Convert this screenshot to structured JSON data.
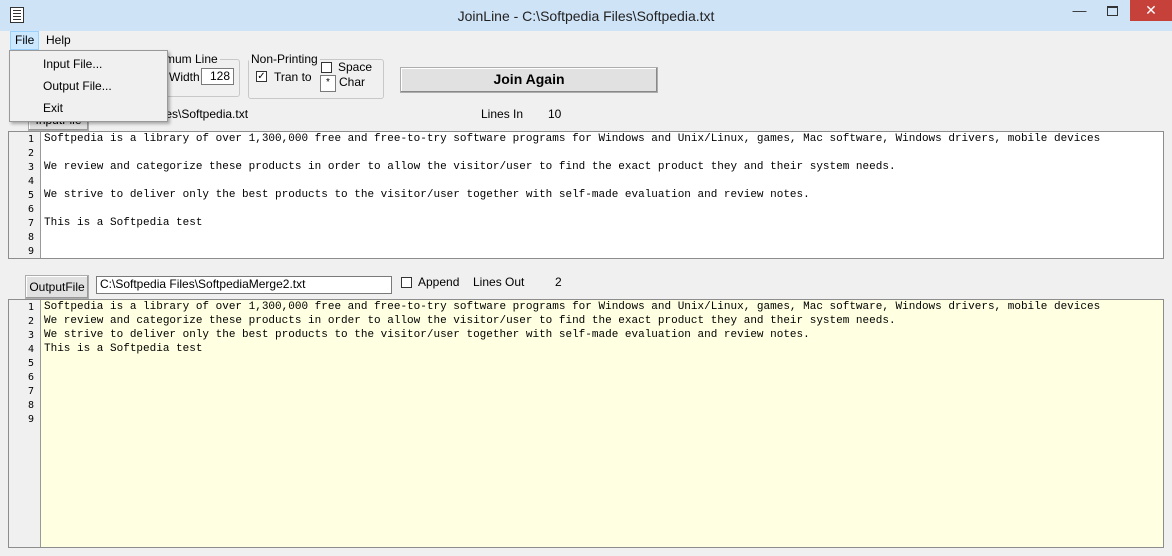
{
  "window": {
    "title": "JoinLine - C:\\Softpedia Files\\Softpedia.txt",
    "minimize": "—",
    "close": "✕"
  },
  "menubar": {
    "file": "File",
    "help": "Help"
  },
  "file_menu": {
    "items": [
      "Input File...",
      "Output File...",
      "Exit"
    ]
  },
  "min_line": {
    "legend": "inimum Line",
    "width_label": "Width",
    "width_value": "128"
  },
  "non_printing": {
    "legend": "Non-Printing",
    "tran_label": "Tran to",
    "tran_checked": "✓",
    "space_label": "Space",
    "char_label": "Char",
    "char_value": "*"
  },
  "join_button": "Join Again",
  "input": {
    "button": "InputFile",
    "path": "iles\\Softpedia.txt",
    "lines_label": "Lines In",
    "lines_value": "10"
  },
  "output": {
    "button": "OutputFile",
    "path": "C:\\Softpedia Files\\SoftpediaMerge2.txt",
    "append_label": "Append",
    "lines_label": "Lines Out",
    "lines_value": "2"
  },
  "input_lines": [
    {
      "n": "1",
      "t": "Softpedia is a library of over 1,300,000 free and free-to-try software programs for Windows and Unix/Linux, games, Mac software, Windows drivers, mobile devices"
    },
    {
      "n": "2",
      "t": ""
    },
    {
      "n": "3",
      "t": "We review and categorize these products in order to allow the visitor/user to find the exact product they and their system needs."
    },
    {
      "n": "4",
      "t": ""
    },
    {
      "n": "5",
      "t": "We strive to deliver only the best products to the visitor/user together with self-made evaluation and review notes."
    },
    {
      "n": "6",
      "t": ""
    },
    {
      "n": "7",
      "t": "This is a Softpedia test"
    },
    {
      "n": "8",
      "t": ""
    },
    {
      "n": "9",
      "t": ""
    }
  ],
  "output_lines": [
    {
      "n": "1",
      "t": "Softpedia is a library of over 1,300,000 free and free-to-try software programs for Windows and Unix/Linux, games, Mac software, Windows drivers, mobile devices"
    },
    {
      "n": "2",
      "t": "We review and categorize these products in order to allow the visitor/user to find the exact product they and their system needs."
    },
    {
      "n": "3",
      "t": "We strive to deliver only the best products to the visitor/user together with self-made evaluation and review notes."
    },
    {
      "n": "4",
      "t": "This is a Softpedia test"
    },
    {
      "n": "5",
      "t": ""
    },
    {
      "n": "6",
      "t": ""
    },
    {
      "n": "7",
      "t": ""
    },
    {
      "n": "8",
      "t": ""
    },
    {
      "n": "9",
      "t": ""
    }
  ]
}
